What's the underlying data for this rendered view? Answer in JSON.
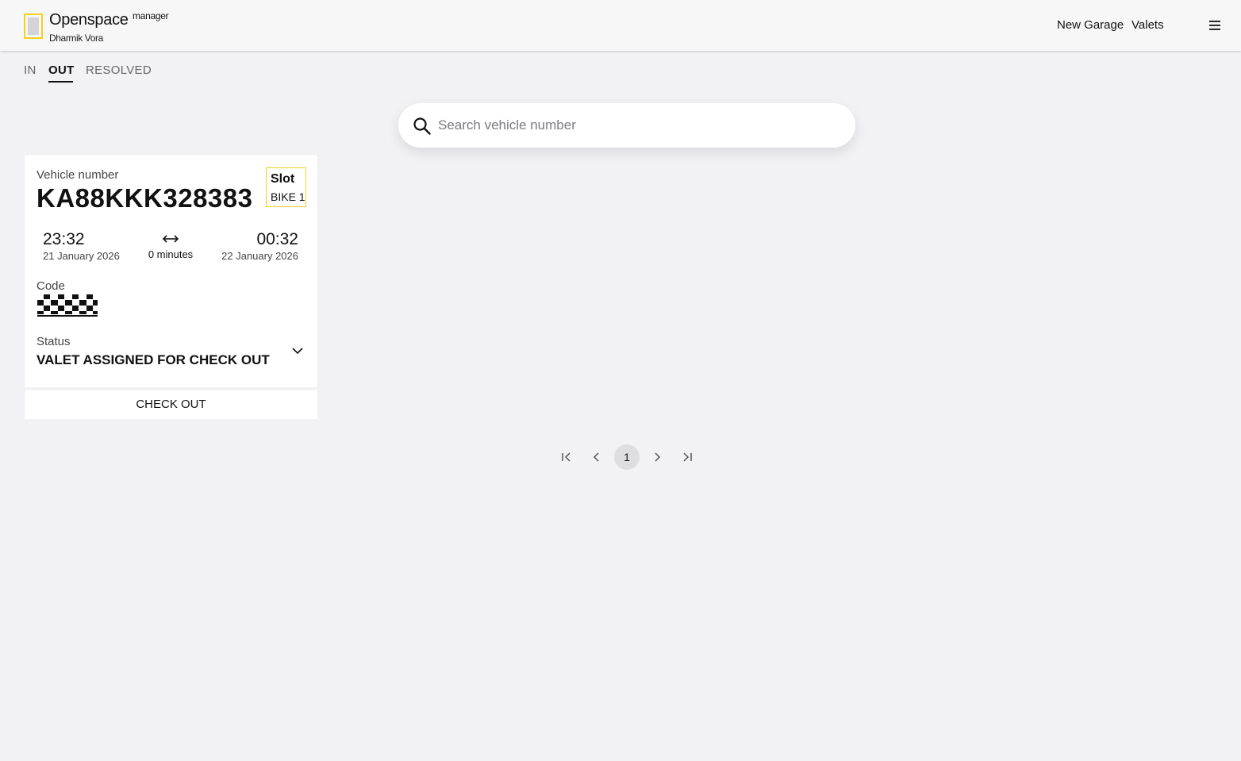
{
  "header": {
    "brand": "Openspace",
    "brand_tag": "manager",
    "user_name": "Dharmik Vora",
    "nav": {
      "new_garage": "New Garage",
      "valets": "Valets"
    },
    "accent_color": "#f2d21b",
    "menu_icon": "hamburger-menu-icon"
  },
  "tabs": [
    {
      "label": "IN",
      "active": false
    },
    {
      "label": "OUT",
      "active": true
    },
    {
      "label": "RESOLVED",
      "active": false
    }
  ],
  "search": {
    "placeholder": "Search vehicle number",
    "value": "",
    "icon": "search-icon"
  },
  "card": {
    "vehicle_label": "Vehicle number",
    "vehicle_number": "KA88KKK328383",
    "slot_title": "Slot",
    "slot_value": "BIKE 1",
    "time_in": "23:32",
    "date_in": "21 January 2026",
    "duration": "0 minutes",
    "time_out": "00:32",
    "date_out": "22 January 2026",
    "code_label": "Code",
    "status_label": "Status",
    "status_value": "VALET ASSIGNED FOR CHECK OUT",
    "checkout_label": "CHECK OUT"
  },
  "pagination": {
    "current_page": "1"
  }
}
